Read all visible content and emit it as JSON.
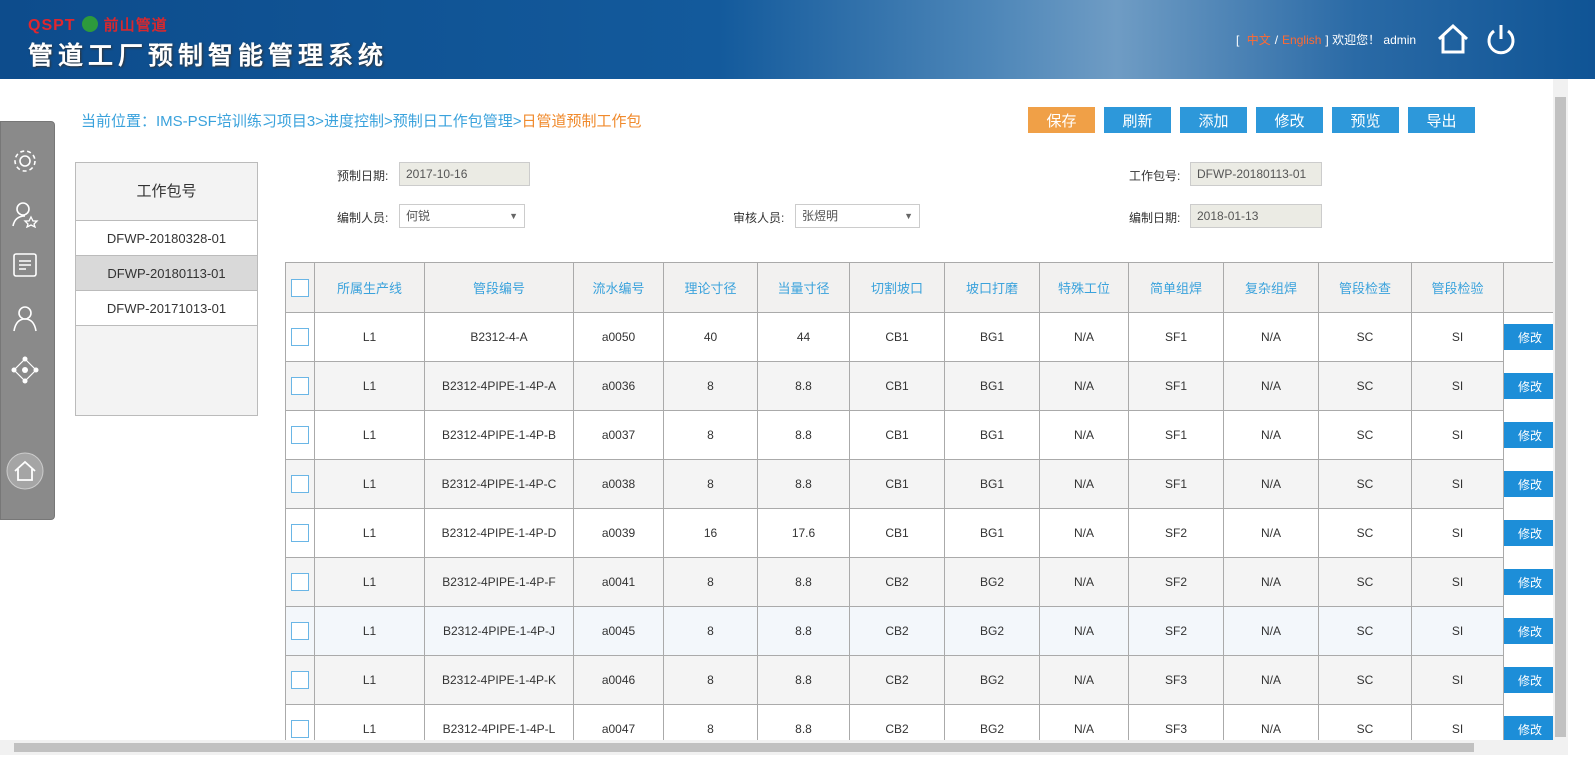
{
  "header": {
    "brand": "QSPT",
    "brand_cn": "前山管道",
    "title": "管道工厂预制智能管理系统",
    "bracket_open": "[",
    "lang_cn": "中文",
    "slash": "/",
    "lang_en": "English",
    "welcome": "] 欢迎您！ admin"
  },
  "breadcrumb": {
    "prefix": "当前位置：IMS-PSF培训练习项目3>进度控制>预制日工作包管理>",
    "current": "日管道预制工作包"
  },
  "toolbar": {
    "save": "保存",
    "refresh": "刷新",
    "add": "添加",
    "edit": "修改",
    "preview": "预览",
    "export": "导出"
  },
  "packages": {
    "header": "工作包号",
    "items": [
      "DFWP-20180328-01",
      "DFWP-20180113-01",
      "DFWP-20171013-01"
    ]
  },
  "form": {
    "prefab_date_label": "预制日期:",
    "prefab_date": "2017-10-16",
    "package_no_label": "工作包号:",
    "package_no": "DFWP-20180113-01",
    "editor_label": "编制人员:",
    "editor": "何锐",
    "reviewer_label": "审核人员:",
    "reviewer": "张煜明",
    "edit_date_label": "编制日期:",
    "edit_date": "2018-01-13"
  },
  "table": {
    "columns": [
      "所属生产线",
      "管段编号",
      "流水编号",
      "理论寸径",
      "当量寸径",
      "切割坡口",
      "坡口打磨",
      "特殊工位",
      "简单组焊",
      "复杂组焊",
      "管段检查",
      "管段检验"
    ],
    "edit_label": "修改",
    "rows": [
      [
        "L1",
        "B2312-4-A",
        "a0050",
        "40",
        "44",
        "CB1",
        "BG1",
        "N/A",
        "SF1",
        "N/A",
        "SC",
        "SI"
      ],
      [
        "L1",
        "B2312-4PIPE-1-4P-A",
        "a0036",
        "8",
        "8.8",
        "CB1",
        "BG1",
        "N/A",
        "SF1",
        "N/A",
        "SC",
        "SI"
      ],
      [
        "L1",
        "B2312-4PIPE-1-4P-B",
        "a0037",
        "8",
        "8.8",
        "CB1",
        "BG1",
        "N/A",
        "SF1",
        "N/A",
        "SC",
        "SI"
      ],
      [
        "L1",
        "B2312-4PIPE-1-4P-C",
        "a0038",
        "8",
        "8.8",
        "CB1",
        "BG1",
        "N/A",
        "SF1",
        "N/A",
        "SC",
        "SI"
      ],
      [
        "L1",
        "B2312-4PIPE-1-4P-D",
        "a0039",
        "16",
        "17.6",
        "CB1",
        "BG1",
        "N/A",
        "SF2",
        "N/A",
        "SC",
        "SI"
      ],
      [
        "L1",
        "B2312-4PIPE-1-4P-F",
        "a0041",
        "8",
        "8.8",
        "CB2",
        "BG2",
        "N/A",
        "SF2",
        "N/A",
        "SC",
        "SI"
      ],
      [
        "L1",
        "B2312-4PIPE-1-4P-J",
        "a0045",
        "8",
        "8.8",
        "CB2",
        "BG2",
        "N/A",
        "SF2",
        "N/A",
        "SC",
        "SI"
      ],
      [
        "L1",
        "B2312-4PIPE-1-4P-K",
        "a0046",
        "8",
        "8.8",
        "CB2",
        "BG2",
        "N/A",
        "SF3",
        "N/A",
        "SC",
        "SI"
      ],
      [
        "L1",
        "B2312-4PIPE-1-4P-L",
        "a0047",
        "8",
        "8.8",
        "CB2",
        "BG2",
        "N/A",
        "SF3",
        "N/A",
        "SC",
        "SI"
      ]
    ]
  }
}
